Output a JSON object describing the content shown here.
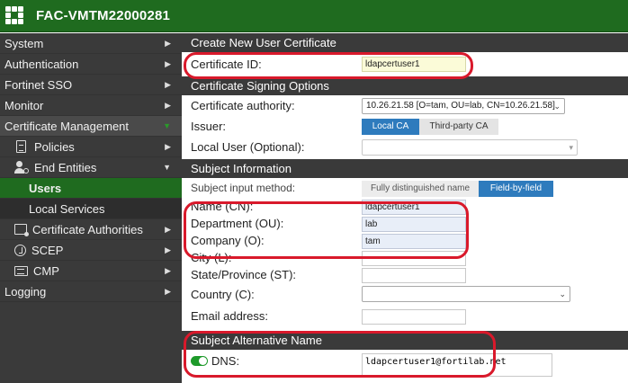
{
  "header": {
    "title": "FAC-VMTM22000281"
  },
  "sidebar": {
    "items": [
      {
        "label": "System"
      },
      {
        "label": "Authentication"
      },
      {
        "label": "Fortinet SSO"
      },
      {
        "label": "Monitor"
      },
      {
        "label": "Certificate Management"
      },
      {
        "label": "Policies"
      },
      {
        "label": "End Entities"
      },
      {
        "label": "Users"
      },
      {
        "label": "Local Services"
      },
      {
        "label": "Certificate Authorities"
      },
      {
        "label": "SCEP"
      },
      {
        "label": "CMP"
      },
      {
        "label": "Logging"
      }
    ]
  },
  "form": {
    "section_create": "Create New User Certificate",
    "cert_id_label": "Certificate ID:",
    "cert_id_value": "ldapcertuser1",
    "section_signing": "Certificate Signing Options",
    "ca_label": "Certificate authority:",
    "ca_value": "10.26.21.58 [O=tam, OU=lab, CN=10.26.21.58]",
    "issuer_label": "Issuer:",
    "issuer_local": "Local CA",
    "issuer_third": "Third-party CA",
    "local_user_label": "Local User (Optional):",
    "local_user_value": "",
    "section_subject": "Subject Information",
    "input_method_label": "Subject input method:",
    "method_fdn": "Fully distinguished name",
    "method_fbf": "Field-by-field",
    "cn_label": "Name (CN):",
    "cn_value": "ldapcertuser1",
    "ou_label": "Department (OU):",
    "ou_value": "lab",
    "o_label": "Company (O):",
    "o_value": "tam",
    "city_label": "City (L):",
    "city_value": "",
    "state_label": "State/Province (ST):",
    "state_value": "",
    "country_label": "Country (C):",
    "country_value": "",
    "email_label": "Email address:",
    "email_value": "",
    "section_san": "Subject Alternative Name",
    "dns_label": "DNS:",
    "dns_value": "ldapcertuser1@fortilab.net"
  },
  "colors": {
    "topbar": "#1f6b1f",
    "sidebar": "#3a3a3a",
    "selected": "#1f6b1f",
    "accent": "#2e7bbd",
    "callout": "#d9192b"
  }
}
